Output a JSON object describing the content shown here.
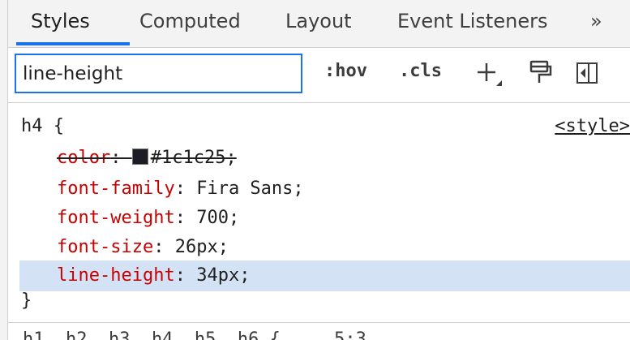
{
  "tabs": [
    {
      "label": "Styles",
      "active": true
    },
    {
      "label": "Computed",
      "active": false
    },
    {
      "label": "Layout",
      "active": false
    },
    {
      "label": "Event Listeners",
      "active": false
    },
    {
      "label": "»",
      "active": false
    }
  ],
  "toolbar": {
    "filter_value": "line-height",
    "hov_label": ":hov",
    "cls_label": ".cls",
    "add_rule_icon": "plus-icon",
    "paint_icon": "paint-roller-icon",
    "sidebar_icon": "toggle-sidebar-icon"
  },
  "rule": {
    "selector": "h4 {",
    "source": "<style>",
    "closing": "}",
    "declarations": [
      {
        "property": "color",
        "value": "#1c1c25",
        "overridden": true,
        "swatch": "#1c1c25"
      },
      {
        "property": "font-family",
        "value": "Fira Sans",
        "overridden": false
      },
      {
        "property": "font-weight",
        "value": "700",
        "overridden": false
      },
      {
        "property": "font-size",
        "value": "26px",
        "overridden": false
      },
      {
        "property": "line-height",
        "value": "34px",
        "overridden": false,
        "highlighted": true
      }
    ]
  },
  "bottom_partial_text": "h1, h2, h3, h4, h5, h6 {    ...   5:3",
  "colors": {
    "accent": "#1a73e8",
    "property": "#c80000",
    "highlight": "#d3e3f5",
    "swatch": "#1c1c25"
  }
}
